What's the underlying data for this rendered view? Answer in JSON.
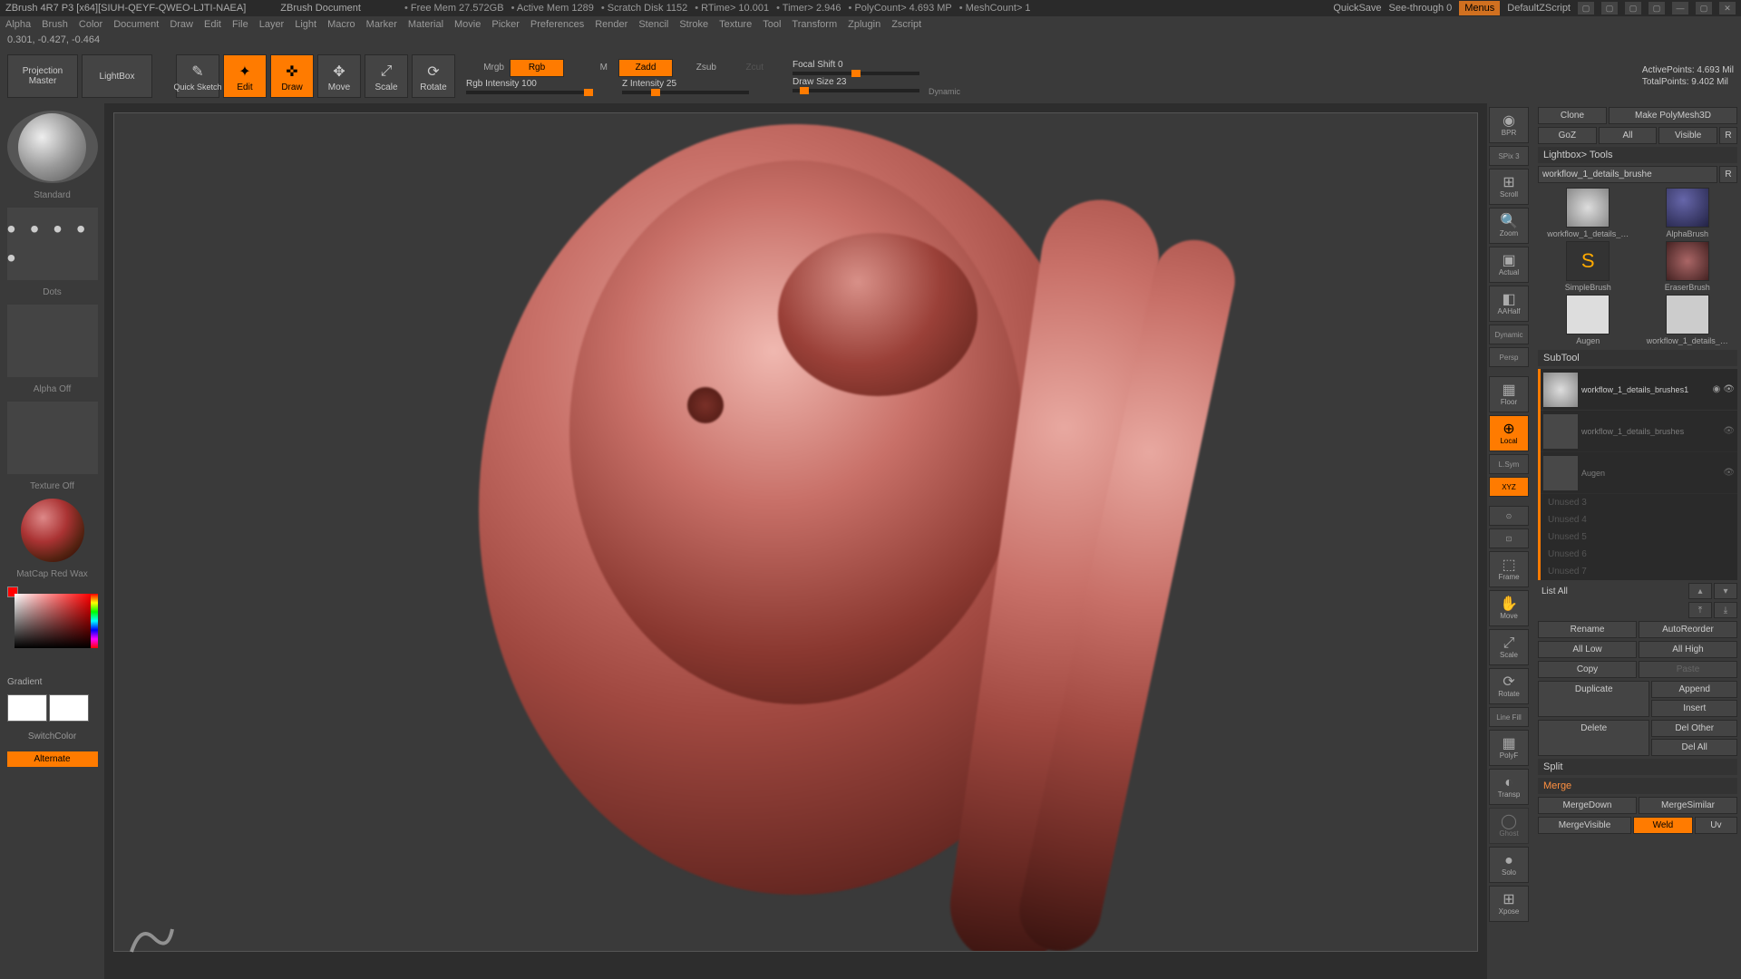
{
  "title_bar": {
    "app_title": "ZBrush 4R7 P3 [x64][SIUH-QEYF-QWEO-LJTI-NAEA]",
    "doc_title": "ZBrush Document",
    "stats": [
      "Free Mem 27.572GB",
      "Active Mem 1289",
      "Scratch Disk 1152",
      "RTime> 10.001",
      "Timer> 2.946",
      "PolyCount> 4.693 MP",
      "MeshCount> 1"
    ],
    "quicksave": "QuickSave",
    "seethrough": "See-through  0",
    "menus": "Menus",
    "script": "DefaultZScript"
  },
  "menu": [
    "Alpha",
    "Brush",
    "Color",
    "Document",
    "Draw",
    "Edit",
    "File",
    "Layer",
    "Light",
    "Macro",
    "Marker",
    "Material",
    "Movie",
    "Picker",
    "Preferences",
    "Render",
    "Stencil",
    "Stroke",
    "Texture",
    "Tool",
    "Transform",
    "Zplugin",
    "Zscript"
  ],
  "coord": "0.301, -0.427, -0.464",
  "shelf": {
    "projection": "Projection\nMaster",
    "lightbox": "LightBox",
    "quicksketch": "Quick Sketch",
    "edit": "Edit",
    "draw": "Draw",
    "move": "Move",
    "scale": "Scale",
    "rotate": "Rotate",
    "mrgb": "Mrgb",
    "rgb": "Rgb",
    "m": "M",
    "rgb_intensity": "Rgb Intensity 100",
    "zadd": "Zadd",
    "zsub": "Zsub",
    "zcut": "Zcut",
    "z_intensity": "Z Intensity 25",
    "focal": "Focal Shift 0",
    "drawsize": "Draw Size 23",
    "dynamic": "Dynamic",
    "active_pts": "ActivePoints: 4.693 Mil",
    "total_pts": "TotalPoints: 9.402 Mil"
  },
  "left": {
    "brush_label": "Standard",
    "stroke_label": "Dots",
    "alpha_label": "Alpha Off",
    "texture_label": "Texture Off",
    "material_label": "MatCap Red Wax",
    "gradient": "Gradient",
    "switchcolor": "SwitchColor",
    "alternate": "Alternate"
  },
  "right_rail": {
    "items": [
      "BPR",
      "SPix 3",
      "Scroll",
      "Zoom",
      "Actual",
      "AAHalf",
      "Dynamic",
      "Persp",
      "Floor",
      "Local",
      "L.Sym",
      "XYZ",
      "Frame",
      "Move",
      "Scale",
      "Rotate",
      "Line Fill",
      "PolyF",
      "Transp",
      "Ghost",
      "Solo",
      "Xpose"
    ]
  },
  "right_panel": {
    "clone": "Clone",
    "make_polymesh": "Make PolyMesh3D",
    "goz": "GoZ",
    "all": "All",
    "visible": "Visible",
    "r": "R",
    "lightbox_tools": "Lightbox> Tools",
    "tool_name": "workflow_1_details_brushe",
    "tools": [
      {
        "name": "workflow_1_details_…"
      },
      {
        "name": "AlphaBrush"
      },
      {
        "name": "SimpleBrush"
      },
      {
        "name": "EraserBrush"
      },
      {
        "name": "Augen"
      },
      {
        "name": "workflow_1_details_…"
      }
    ],
    "subtool_hdr": "SubTool",
    "subtools": [
      {
        "name": "workflow_1_details_brushes1",
        "active": true
      },
      {
        "name": "workflow_1_details_brushes",
        "active": false
      },
      {
        "name": "Augen",
        "active": false
      }
    ],
    "slots": [
      "Unused 3",
      "Unused 4",
      "Unused 5",
      "Unused 6",
      "Unused 7"
    ],
    "listall": "List All",
    "buttons": {
      "rename": "Rename",
      "autoreorder": "AutoReorder",
      "alllow": "All Low",
      "allhigh": "All High",
      "copy": "Copy",
      "paste": "Paste",
      "duplicate": "Duplicate",
      "append": "Append",
      "insert": "Insert",
      "delete": "Delete",
      "delother": "Del Other",
      "delall": "Del All",
      "split": "Split",
      "merge": "Merge",
      "mergedown": "MergeDown",
      "mergesimilar": "MergeSimilar",
      "mergevisible": "MergeVisible",
      "weld": "Weld",
      "uv": "Uv"
    }
  }
}
